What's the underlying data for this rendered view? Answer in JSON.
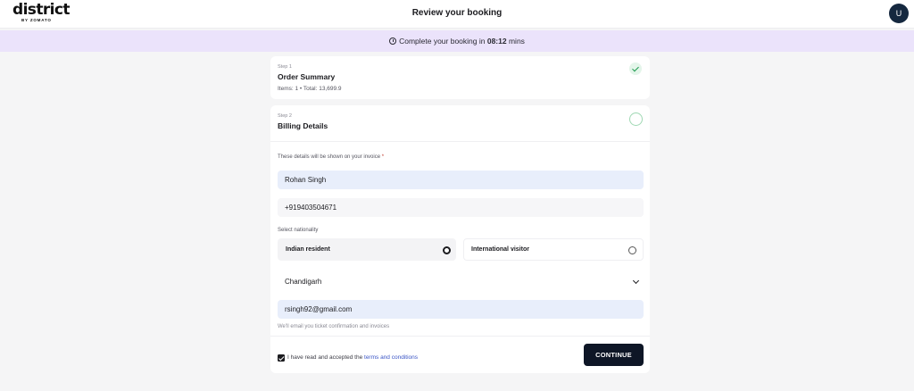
{
  "header": {
    "logo_text": "district",
    "logo_sub": "BY ZOMATO",
    "title": "Review your booking",
    "avatar_initial": "U"
  },
  "timer": {
    "prefix": "Complete your booking in",
    "time": "08:12",
    "suffix": "mins"
  },
  "steps": [
    {
      "label": "Step 1",
      "title": "Order Summary",
      "meta": "Items: 1 • Total: 13,699.9",
      "status": "complete"
    },
    {
      "label": "Step 2",
      "title": "Billing Details",
      "status": "in-progress"
    }
  ],
  "form": {
    "intro": "These details will be shown on your invoice",
    "required_mark": "*",
    "name": "Rohan Singh",
    "phone": "+919403504671",
    "nationality_label": "Select nationality",
    "options": [
      {
        "label": "Indian resident",
        "selected": true
      },
      {
        "label": "International visitor",
        "selected": false
      }
    ],
    "state": "Chandigarh",
    "email": "rsingh92@gmail.com",
    "email_helper": "We'll email you ticket confirmation and invoices",
    "terms_prefix": "I have read and accepted the",
    "terms_link": "terms and conditions",
    "terms_checked": true,
    "continue_label": "CONTINUE"
  },
  "colors": {
    "timer_bg": "#ebe3fb",
    "primary_button": "#0e1626",
    "link": "#3a55c6",
    "success": "#1d9a4f"
  },
  "icons": [
    "clock-icon",
    "check-icon",
    "chevron-down-icon",
    "checkbox-checked-icon"
  ]
}
